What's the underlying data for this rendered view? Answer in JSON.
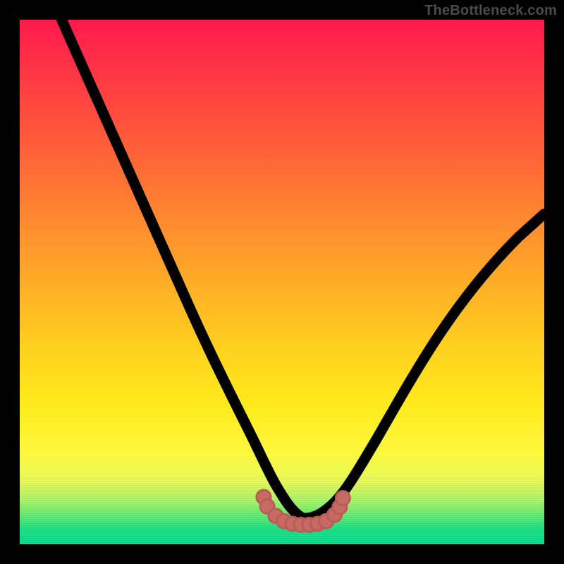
{
  "watermark": "TheBottleneck.com",
  "colors": {
    "frame_bg": "#000000",
    "watermark_fg": "#4b4b4b",
    "curve_stroke": "#000000",
    "marker_fill": "#c86a64",
    "gradient_top": "#ff1a4b",
    "gradient_bottom": "#0bdd8d"
  },
  "chart_data": {
    "type": "line",
    "title": "",
    "xlabel": "",
    "ylabel": "",
    "xlim": [
      0,
      100
    ],
    "ylim": [
      0,
      100
    ],
    "grid": false,
    "legend": false,
    "series": [
      {
        "name": "bottleneck-curve",
        "x": [
          8,
          12,
          16,
          20,
          24,
          28,
          32,
          36,
          40,
          44,
          47,
          49,
          51,
          53,
          55,
          57,
          59,
          62,
          66,
          70,
          75,
          80,
          86,
          92,
          100
        ],
        "y": [
          100,
          91,
          82,
          73,
          64,
          55,
          46,
          37,
          29,
          21,
          15,
          11,
          8,
          6,
          5,
          5,
          6,
          8,
          13,
          19,
          27,
          35,
          44,
          52,
          61
        ]
      }
    ],
    "markers": {
      "name": "highlight-points",
      "shape": "circle-cluster",
      "approx_region_x": [
        46,
        62
      ],
      "approx_region_y": [
        3,
        10
      ],
      "points": [
        {
          "x": 46.5,
          "y": 9.0
        },
        {
          "x": 47.2,
          "y": 7.2
        },
        {
          "x": 48.8,
          "y": 5.4
        },
        {
          "x": 50.4,
          "y": 4.4
        },
        {
          "x": 52.0,
          "y": 3.9
        },
        {
          "x": 53.6,
          "y": 3.7
        },
        {
          "x": 55.2,
          "y": 3.7
        },
        {
          "x": 56.8,
          "y": 3.9
        },
        {
          "x": 58.4,
          "y": 4.4
        },
        {
          "x": 60.0,
          "y": 5.6
        },
        {
          "x": 61.0,
          "y": 7.1
        },
        {
          "x": 61.6,
          "y": 8.8
        }
      ]
    },
    "annotations": []
  }
}
